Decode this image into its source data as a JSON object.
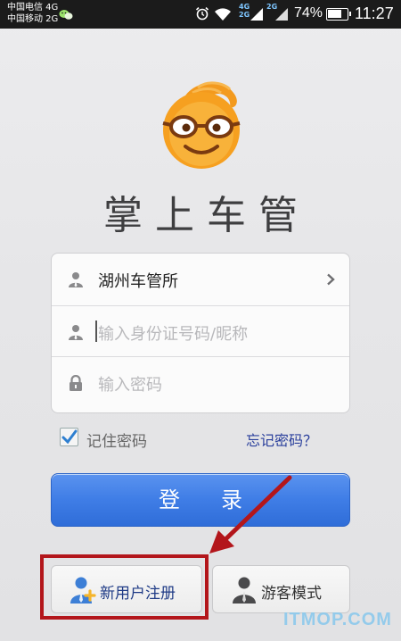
{
  "status_bar": {
    "carrier_1": "中国电信 4G",
    "carrier_2": "中国移动 2G",
    "network_1": "4G",
    "network_2": "2G",
    "network_3": "2G",
    "battery_percent": "74%",
    "battery_level": 0.74,
    "time": "11:27"
  },
  "app": {
    "title": "掌上车管"
  },
  "form": {
    "location_value": "湖州车管所",
    "id_placeholder": "输入身份证号码/昵称",
    "password_placeholder": "输入密码"
  },
  "options": {
    "remember_label": "记住密码",
    "remember_checked": true,
    "forgot_label": "忘记密码？"
  },
  "actions": {
    "login_label": "登录",
    "register_label": "新用户注册",
    "guest_label": "游客模式"
  },
  "watermark": "ITMOP.COM",
  "colors": {
    "login_button": "#3f7de6",
    "link": "#2a3f9c",
    "highlight": "#b3161b"
  },
  "icons": {
    "location": "user-icon",
    "id": "user-icon",
    "password": "lock-icon",
    "register": "add-user-icon",
    "guest": "guest-user-icon"
  }
}
